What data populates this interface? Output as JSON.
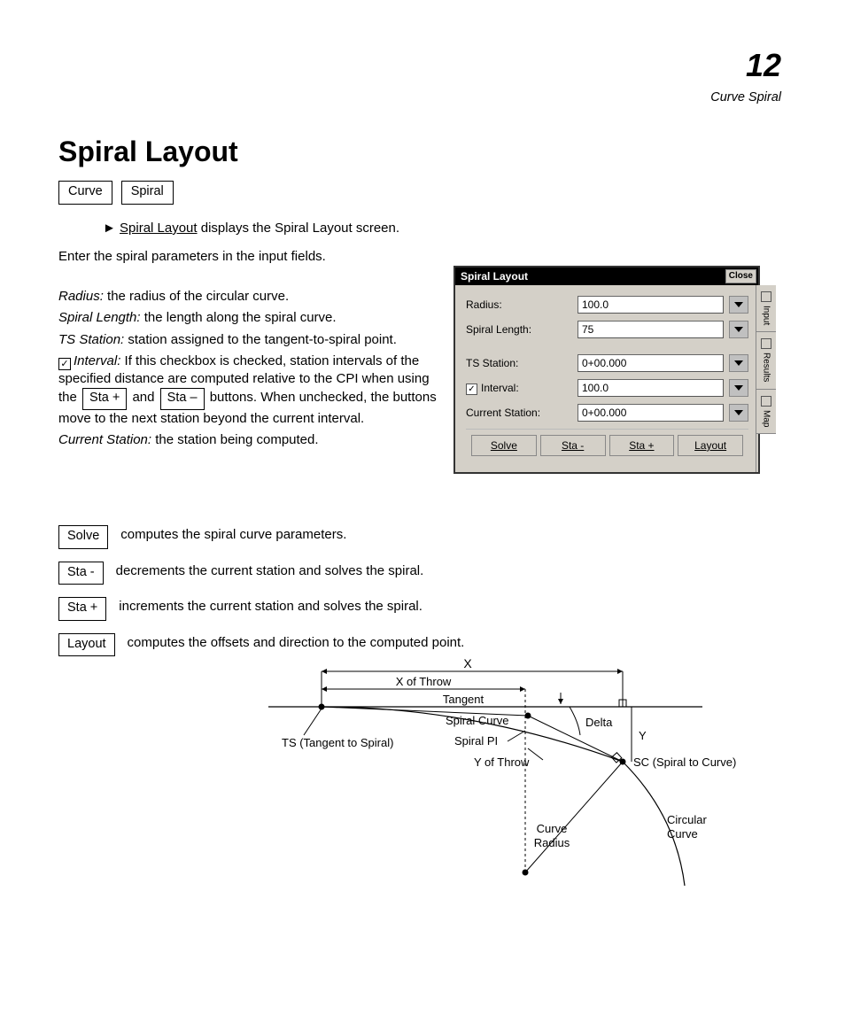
{
  "page": {
    "section_number": "12",
    "breadcrumb": "Curve   Spiral",
    "title": "Spiral Layout",
    "nav": {
      "curve": "Curve",
      "spiral": "Spiral"
    },
    "intro_prefix": "► ",
    "intro_link": "Spiral Layout",
    "intro_rest": " displays the Spiral Layout screen.",
    "intro_para": "Enter the spiral parameters in the input fields."
  },
  "fields": {
    "radius_label": "Radius:",
    "radius_desc": " the radius of the circular curve.",
    "spiral_len_label": "Spiral Length:",
    "spiral_len_desc": " the length along the spiral curve.",
    "ts_label": "TS Station:",
    "ts_desc": " station assigned to the tangent-to-spiral point.",
    "interval_chk_label": "Interval:",
    "interval_desc_1": " If this checkbox is checked, station intervals of the specified distance are computed relative to the CPI when using the ",
    "interval_desc_2": " and ",
    "interval_desc_3": " buttons. When unchecked, the buttons move to the next station beyond the current interval.",
    "current_label": "Current Station:",
    "current_desc": " the station being computed."
  },
  "dialog": {
    "title": "Spiral Layout",
    "close": "Close",
    "labels": {
      "radius": "Radius:",
      "spiral_length": "Spiral Length:",
      "ts_station": "TS Station:",
      "interval": "Interval:",
      "current_station": "Current Station:"
    },
    "values": {
      "radius": "100.0",
      "spiral_length": "75",
      "ts_station": "0+00.000",
      "interval": "100.0",
      "current_station": "0+00.000"
    },
    "interval_checked": "✓",
    "buttons": {
      "solve": "Solve",
      "sta_minus": "Sta -",
      "sta_plus": "Sta +",
      "layout": "Layout"
    },
    "side_tabs": {
      "input": "Input",
      "results": "Results",
      "map": "Map"
    }
  },
  "buttons_block": {
    "solve": "Solve",
    "solve_desc": "computes the spiral curve parameters.",
    "sta_minus": "Sta -",
    "sta_minus_desc": "decrements the current station and solves the spiral.",
    "sta_plus": "Sta +",
    "sta_plus_desc": "increments the current station and solves the spiral.",
    "layout": "Layout",
    "layout_desc": "computes the offsets and direction to the computed point."
  },
  "inline_buttons": {
    "sta_plus": "Sta +",
    "sta_minus": "Sta –"
  },
  "diagram": {
    "X": "X",
    "XOfThrow": "X of Throw",
    "Tangent": "Tangent",
    "SpiralCurve": "Spiral Curve",
    "SpiralPI": "Spiral PI",
    "TS": "TS (Tangent to Spiral)",
    "Delta": "Delta",
    "Y": "Y",
    "YOfThrow": "Y of Throw",
    "SC": "SC (Spiral to Curve)",
    "CurveRadius": "Curve\nRadius",
    "CircularCurve": "Circular\nCurve"
  }
}
